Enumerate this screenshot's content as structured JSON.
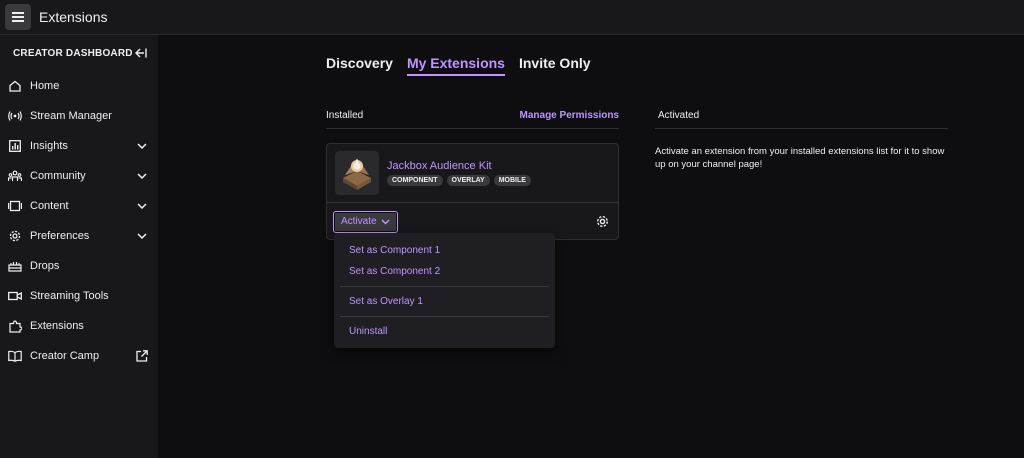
{
  "header": {
    "title": "Extensions"
  },
  "sidebar": {
    "heading": "CREATOR DASHBOARD",
    "items": [
      {
        "label": "Home",
        "icon": "home-icon",
        "trail": ""
      },
      {
        "label": "Stream Manager",
        "icon": "broadcast-icon",
        "trail": ""
      },
      {
        "label": "Insights",
        "icon": "chart-icon",
        "trail": "chevron-down"
      },
      {
        "label": "Community",
        "icon": "community-icon",
        "trail": "chevron-down"
      },
      {
        "label": "Content",
        "icon": "content-icon",
        "trail": "chevron-down"
      },
      {
        "label": "Preferences",
        "icon": "gear-icon",
        "trail": "chevron-down"
      },
      {
        "label": "Drops",
        "icon": "drops-icon",
        "trail": ""
      },
      {
        "label": "Streaming Tools",
        "icon": "camera-icon",
        "trail": ""
      },
      {
        "label": "Extensions",
        "icon": "puzzle-icon",
        "trail": ""
      },
      {
        "label": "Creator Camp",
        "icon": "book-icon",
        "trail": "external-link"
      }
    ]
  },
  "tabs": [
    {
      "label": "Discovery",
      "active": false
    },
    {
      "label": "My Extensions",
      "active": true
    },
    {
      "label": "Invite Only",
      "active": false
    }
  ],
  "installed": {
    "heading": "Installed",
    "manage_link": "Manage Permissions",
    "extension": {
      "name": "Jackbox Audience Kit",
      "tags": [
        "COMPONENT",
        "OVERLAY",
        "MOBILE"
      ],
      "activate_label": "Activate"
    }
  },
  "activated": {
    "heading": "Activated",
    "message": "Activate an extension from your installed extensions list for it to show up on your channel page!"
  },
  "dropdown": {
    "group1": [
      "Set as Component 1",
      "Set as Component 2"
    ],
    "group2": [
      "Set as Overlay 1"
    ],
    "group3": [
      "Uninstall"
    ]
  },
  "colors": {
    "accent": "#bf94ff",
    "background": "#0e0e10",
    "panel": "#18181b",
    "text": "#efeff1"
  }
}
